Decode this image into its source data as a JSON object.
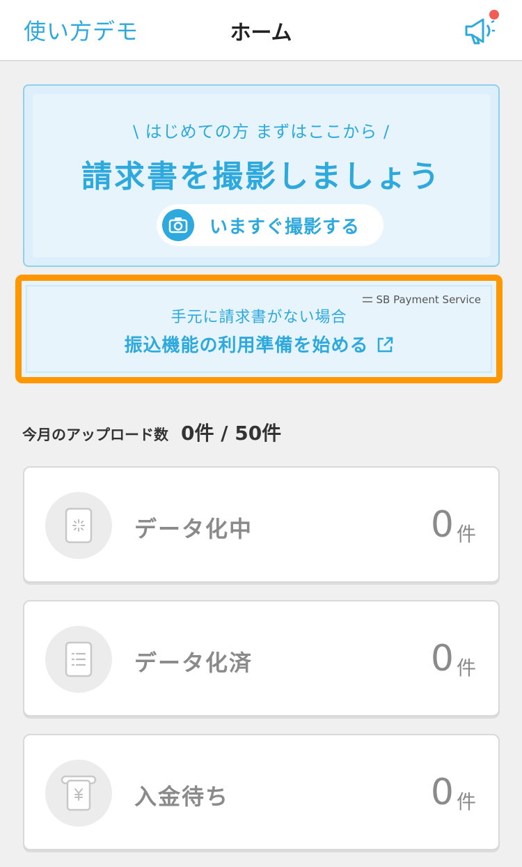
{
  "header": {
    "left_link": "使い方デモ",
    "title": "ホーム",
    "notification_icon": "megaphone-icon"
  },
  "hero": {
    "subtitle": "\\ はじめての方 まずはここから /",
    "title": "請求書を撮影しましょう",
    "button_label": "いますぐ撮影する",
    "button_icon": "camera-icon"
  },
  "transfer": {
    "brand": "SB Payment Service",
    "subtitle": "手元に請求書がない場合",
    "link": "振込機能の利用準備を始める",
    "highlight_color": "#ff9800"
  },
  "upload": {
    "label": "今月のアップロード数",
    "value": "0件 / 50件"
  },
  "cards": [
    {
      "label": "データ化中",
      "count": "0",
      "unit": "件",
      "icon": "processing-document-icon"
    },
    {
      "label": "データ化済",
      "count": "0",
      "unit": "件",
      "icon": "list-document-icon"
    },
    {
      "label": "入金待ち",
      "count": "0",
      "unit": "件",
      "icon": "yen-receipt-icon"
    }
  ],
  "colors": {
    "accent": "#2ea9dd",
    "badge": "#f25c54"
  }
}
